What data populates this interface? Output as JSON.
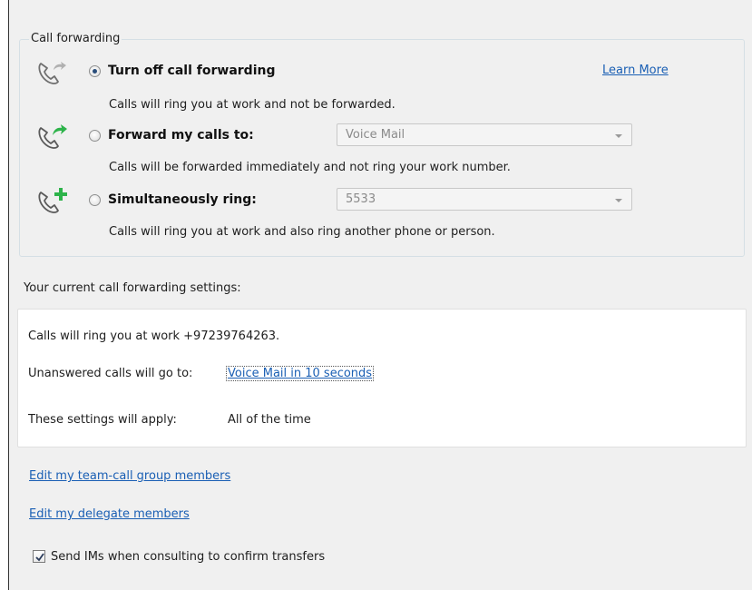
{
  "call_forwarding": {
    "group_title": "Call forwarding",
    "learn_more": "Learn More",
    "options": [
      {
        "label": "Turn off call forwarding",
        "description": "Calls will ring you at work and not be forwarded.",
        "selected": true,
        "icon": "phone-arrow-gray-icon"
      },
      {
        "label": "Forward my calls to:",
        "description": "Calls will be forwarded immediately and not ring your work number.",
        "selected": false,
        "icon": "phone-arrow-green-icon",
        "dropdown_value": "Voice Mail"
      },
      {
        "label": "Simultaneously ring:",
        "description": "Calls will ring you at work and also ring another phone or person.",
        "selected": false,
        "icon": "phone-plus-green-icon",
        "dropdown_value": "5533"
      }
    ]
  },
  "current_settings": {
    "heading": "Your current call forwarding settings:",
    "ring_text": "Calls will ring you at work +97239764263.",
    "unanswered_label": "Unanswered calls will go to:",
    "unanswered_value": "Voice Mail in 10 seconds",
    "applies_label": "These settings will apply:",
    "applies_value": "All of the time"
  },
  "links": {
    "team_call": "Edit my team-call group members",
    "delegate": "Edit my delegate members"
  },
  "send_ims": {
    "label": "Send IMs when consulting to confirm transfers",
    "checked": true
  },
  "colors": {
    "link": "#1a5fb4",
    "icon_green": "#2db34a",
    "icon_gray": "#9a9a9a",
    "background": "#f0f0f0"
  }
}
